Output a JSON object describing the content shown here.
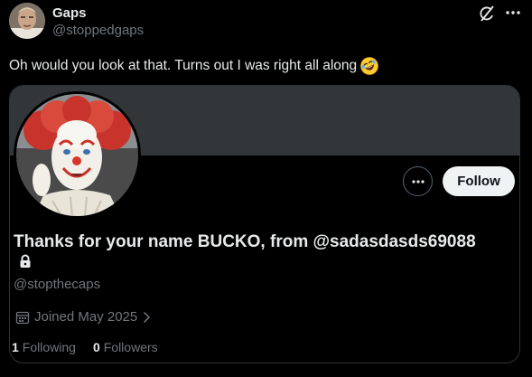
{
  "tweet": {
    "author_name": "Gaps",
    "author_handle": "@stoppedgaps",
    "text": "Oh would you look at that. Turns out I was right all along",
    "emoji": "rolling-on-floor-laughing-emoji"
  },
  "card": {
    "follow_label": "Follow",
    "display_name": "Thanks for your name BUCKO, from @sadasdasds69088",
    "handle": "@stopthecaps",
    "joined": "Joined May 2025",
    "following_count": "1",
    "following_label": "Following",
    "followers_count": "0",
    "followers_label": "Followers",
    "banner_color": "#333639"
  },
  "icons": {
    "grok": "grok-icon",
    "more": "more-horizontal-icon",
    "lock": "lock-icon",
    "calendar": "calendar-icon",
    "chevron": "chevron-right-icon"
  }
}
